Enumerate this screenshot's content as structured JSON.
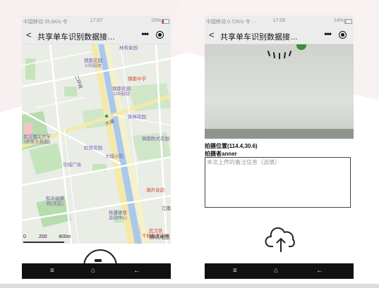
{
  "left_phone": {
    "status": {
      "network": "中国移动 25.6K/s 令",
      "time": "17:07",
      "battery": "15%"
    },
    "nav": {
      "back": "<",
      "title": "共享单车识别数据接…",
      "more": "•••"
    },
    "map_labels": [
      "林秀家园",
      "钢都花园\n125街坊",
      "钢都中学",
      "钢都花园\n126街坊",
      "柴林花园",
      "钢都欧式花园",
      "武汉理工大学\n(余家头校区)",
      "虹桥花园",
      "大城小院",
      "华城广场",
      "和平街铁\n机(东区)",
      "潮声音韵",
      "极速体育\n运动中心",
      "武汉铁\n千鲜批发市场",
      "江南",
      "腾讯地图",
      "二环线",
      "大道"
    ],
    "scale": {
      "zero": "0",
      "mid": "200",
      "end": "400m"
    },
    "sysnav": {
      "menu": "≡",
      "home": "⌂",
      "back": "←"
    }
  },
  "right_phone": {
    "status": {
      "network": "中国移动 0.72K/s 令 ···",
      "time": "17:09",
      "battery": "14%"
    },
    "nav": {
      "back": "<",
      "title": "共享单车识别数据接…",
      "more": "•••"
    },
    "location_label": "拍摄位置(114.4,30.6)",
    "photographer_label": "拍摄者anner",
    "note_placeholder": "本次上传的备注信息（选填）",
    "sysnav": {
      "menu": "≡",
      "home": "⌂",
      "back": "←"
    }
  },
  "colors": {
    "nav_bg": "#ececec",
    "sysnav_bg": "#111111",
    "road": "#f4e9a8",
    "water": "#aac8e8",
    "park": "#b7dcae"
  },
  "icons": [
    "back-icon",
    "more-icon",
    "target-icon",
    "camera-icon",
    "upload-cloud-icon",
    "menu-icon",
    "home-icon",
    "back-arrow-icon"
  ]
}
